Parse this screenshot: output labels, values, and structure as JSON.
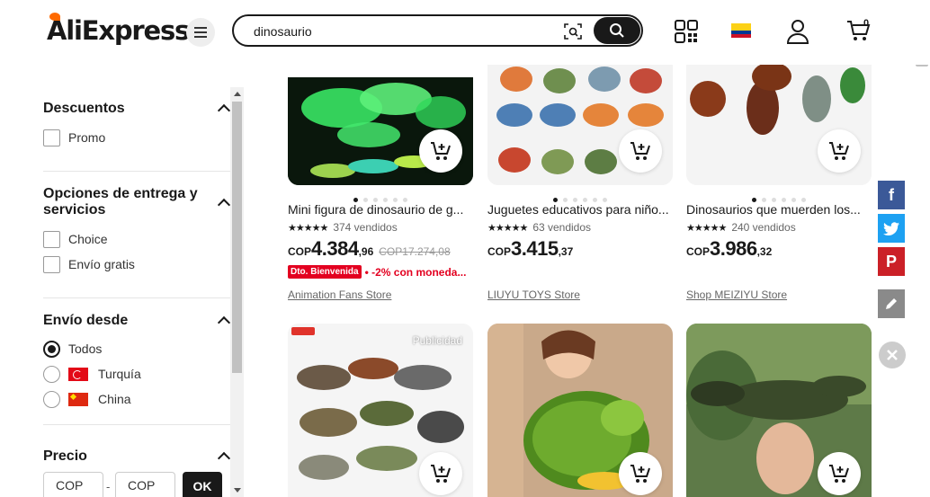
{
  "header": {
    "logo_text": "AliExpress",
    "search_value": "dinosaurio",
    "cart_count": "0"
  },
  "filters": {
    "discounts": {
      "title": "Descuentos",
      "options": [
        "Promo"
      ]
    },
    "delivery": {
      "title": "Opciones de entrega y servicios",
      "options": [
        "Choice",
        "Envío gratis"
      ]
    },
    "ship_from": {
      "title": "Envío desde",
      "selected": "Todos",
      "options": [
        "Todos",
        "Turquía",
        "China"
      ]
    },
    "price": {
      "title": "Precio",
      "min_placeholder": "COP",
      "max_placeholder": "COP",
      "separator": "-",
      "ok_label": "OK"
    }
  },
  "products": [
    {
      "title": "Mini figura de dinosaurio de g...",
      "stars": "★★★★★",
      "sold": "374 vendidos",
      "currency": "COP",
      "price_int": "4.384",
      "price_dec": ",96",
      "old_price": "COP17.274,08",
      "promo_tag": "Dto. Bienvenida",
      "promo_text": "• -2% con moneda...",
      "store": "Animation Fans Store"
    },
    {
      "title": "Juguetes educativos para niño...",
      "stars": "★★★★★",
      "sold": "63 vendidos",
      "currency": "COP",
      "price_int": "3.415",
      "price_dec": ",37",
      "store": "LIUYU TOYS Store"
    },
    {
      "title": "Dinosaurios que muerden los...",
      "stars": "★★★★★",
      "sold": "240 vendidos",
      "currency": "COP",
      "price_int": "3.986",
      "price_dec": ",32",
      "store": "Shop MEIZIYU Store"
    },
    {
      "ad_label": "Publicidad"
    },
    {},
    {}
  ],
  "colors": {
    "brand": "#191919",
    "accent_red": "#e30020",
    "facebook": "#3b5998",
    "twitter": "#1da1f2",
    "pinterest": "#cb2027"
  },
  "share": [
    "facebook-icon",
    "twitter-icon",
    "pinterest-icon",
    "edit-icon"
  ]
}
